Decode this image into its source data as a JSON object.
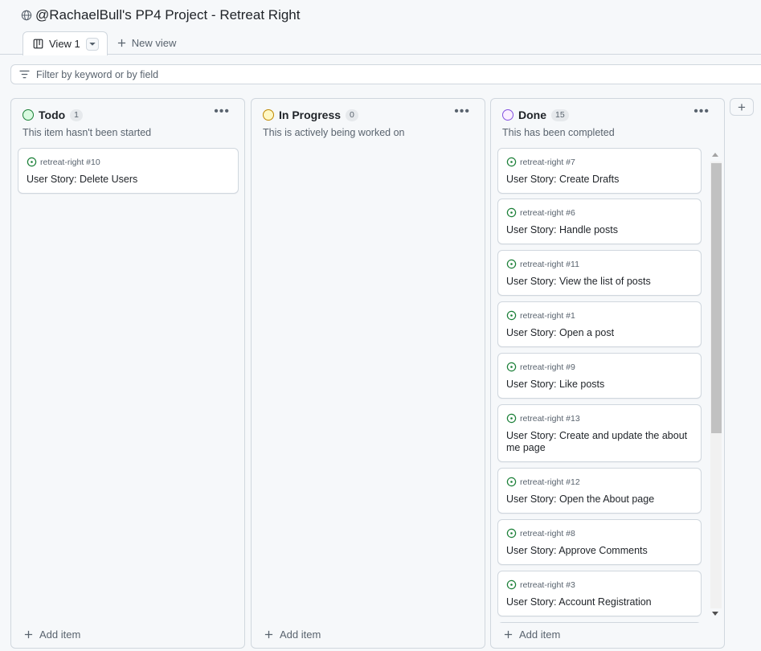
{
  "project": {
    "title": "@RachaelBull's PP4 Project - Retreat Right",
    "visibility_icon": "globe-icon"
  },
  "tabs": [
    {
      "label": "View 1",
      "icon": "board-icon",
      "active": true
    }
  ],
  "new_view_label": "New view",
  "filter": {
    "placeholder": "Filter by keyword or by field"
  },
  "columns": [
    {
      "name": "Todo",
      "count": "1",
      "description": "This item hasn't been started",
      "color": "#1a7f37",
      "add_label": "Add item",
      "cards": [
        {
          "ref": "retreat-right #10",
          "title": "User Story: Delete Users"
        }
      ]
    },
    {
      "name": "In Progress",
      "count": "0",
      "description": "This is actively being worked on",
      "color": "#bf8700",
      "add_label": "Add item",
      "cards": []
    },
    {
      "name": "Done",
      "count": "15",
      "description": "This has been completed",
      "color": "#8250df",
      "add_label": "Add item",
      "cards": [
        {
          "ref": "retreat-right #7",
          "title": "User Story: Create Drafts"
        },
        {
          "ref": "retreat-right #6",
          "title": "User Story: Handle posts"
        },
        {
          "ref": "retreat-right #11",
          "title": "User Story: View the list of posts"
        },
        {
          "ref": "retreat-right #1",
          "title": "User Story: Open a post"
        },
        {
          "ref": "retreat-right #9",
          "title": "User Story: Like posts"
        },
        {
          "ref": "retreat-right #13",
          "title": "User Story: Create and update the about me page"
        },
        {
          "ref": "retreat-right #12",
          "title": "User Story: Open the About page"
        },
        {
          "ref": "retreat-right #8",
          "title": "User Story: Approve Comments"
        },
        {
          "ref": "retreat-right #3",
          "title": "User Story: Account Registration"
        }
      ]
    }
  ],
  "issue_icon": "open-issue-icon",
  "issue_color": "#1a7f37",
  "add_column_label": "+"
}
